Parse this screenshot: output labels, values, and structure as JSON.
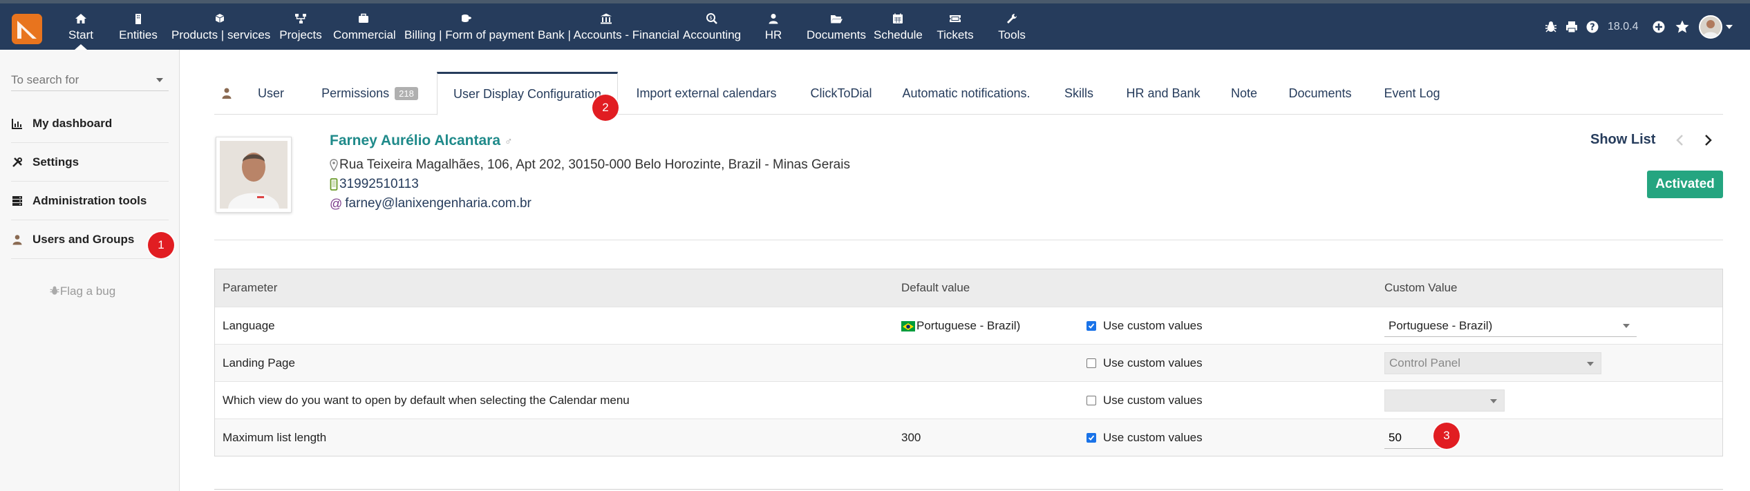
{
  "topbar": {
    "menu": [
      {
        "id": "start",
        "label": "Start",
        "icon": "home-icon"
      },
      {
        "id": "entities",
        "label": "Entities",
        "icon": "building-icon"
      },
      {
        "id": "products",
        "label": "Products | services",
        "icon": "cube-icon"
      },
      {
        "id": "projects",
        "label": "Projects",
        "icon": "sitemap-icon"
      },
      {
        "id": "commercial",
        "label": "Commercial",
        "icon": "briefcase-icon"
      },
      {
        "id": "billing",
        "label": "Billing | Form of payment",
        "icon": "coins-icon"
      },
      {
        "id": "bank",
        "label": "Bank | Accounts - Financial",
        "icon": "bank-icon"
      },
      {
        "id": "accounting",
        "label": "Accounting",
        "icon": "search-dollar-icon"
      },
      {
        "id": "hr",
        "label": "HR",
        "icon": "user-icon"
      },
      {
        "id": "documents",
        "label": "Documents",
        "icon": "folder-open-icon"
      },
      {
        "id": "schedule",
        "label": "Schedule",
        "icon": "calendar-icon"
      },
      {
        "id": "tickets",
        "label": "Tickets",
        "icon": "ticket-icon"
      },
      {
        "id": "tools",
        "label": "Tools",
        "icon": "wrench-icon"
      }
    ],
    "active": "start",
    "version": "18.0.4",
    "right_icons": [
      "bug-icon",
      "printer-icon",
      "help-icon",
      "plus-circle-icon",
      "star-icon"
    ]
  },
  "sidebar": {
    "search_placeholder": "To search for",
    "items": [
      {
        "label": "My dashboard",
        "icon": "chart-icon"
      },
      {
        "label": "Settings",
        "icon": "tools-icon"
      },
      {
        "label": "Administration tools",
        "icon": "server-icon"
      },
      {
        "label": "Users and Groups",
        "icon": "user-icon"
      }
    ],
    "flag_bug": "Flag a bug"
  },
  "callouts": [
    "1",
    "2",
    "3"
  ],
  "tabs": [
    {
      "label": "User"
    },
    {
      "label": "Permissions",
      "count": "218"
    },
    {
      "label": "User Display Configuration"
    },
    {
      "label": "Import external calendars"
    },
    {
      "label": "ClickToDial"
    },
    {
      "label": "Automatic notifications."
    },
    {
      "label": "Skills"
    },
    {
      "label": "HR and Bank"
    },
    {
      "label": "Note"
    },
    {
      "label": "Documents"
    },
    {
      "label": "Event Log"
    }
  ],
  "active_tab": "User Display Configuration",
  "user": {
    "name": "Farney Aurélio Alcantara",
    "address": "Rua Teixeira Magalhães, 106, Apt 202, 30150-000 Belo Horozinte, Brazil - Minas Gerais",
    "phone": "31992510113",
    "email": "farney@lanixengenharia.com.br",
    "status": "Activated",
    "show_list": "Show List"
  },
  "table": {
    "headers": {
      "parameter": "Parameter",
      "default": "Default value",
      "custom": "Custom Value"
    },
    "rows": [
      {
        "parameter": "Language",
        "default": "Portuguese - Brazil)",
        "use_custom": true,
        "use_label": "Use custom values",
        "custom_value": "Portuguese - Brazil)"
      },
      {
        "parameter": "Landing Page",
        "default": "",
        "use_custom": false,
        "use_label": "Use custom values",
        "custom_value": "Control Panel"
      },
      {
        "parameter": "Which view do you want to open by default when selecting the Calendar menu",
        "default": "",
        "use_custom": false,
        "use_label": "Use custom values",
        "custom_value": ""
      },
      {
        "parameter": "Maximum list length",
        "default": "300",
        "use_custom": true,
        "use_label": "Use custom values",
        "custom_value": "50"
      }
    ]
  },
  "colors": {
    "topbar": "#263c5c",
    "accent_teal": "#1f8a8a",
    "activated": "#25a580",
    "callout": "#e11d22",
    "logo": "#e8741e"
  }
}
